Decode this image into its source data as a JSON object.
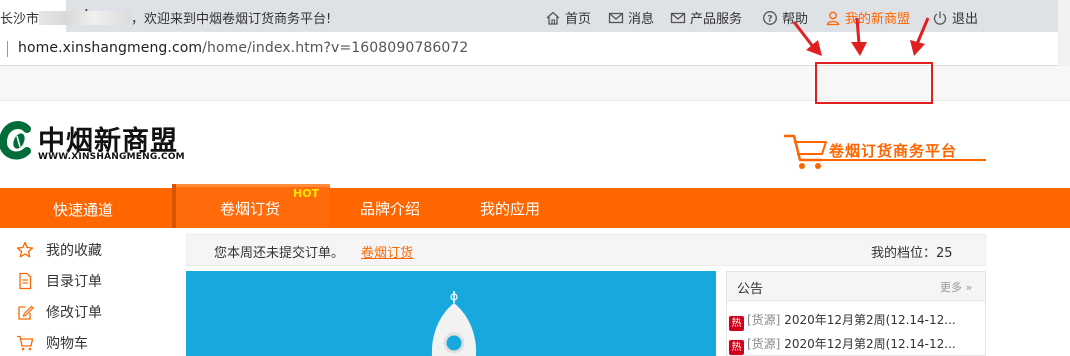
{
  "browser": {
    "tab_close": "×",
    "new_tab": "+",
    "url_host": "home.xinshangmeng.com",
    "url_path": "/home/index.htm?v=1608090786072"
  },
  "topbar": {
    "city": "长沙市",
    "welcome": "，欢迎来到中烟卷烟订货商务平台!",
    "nav": [
      {
        "label": "首页",
        "icon": "home-icon"
      },
      {
        "label": "消息",
        "icon": "mail-icon"
      },
      {
        "label": "产品服务",
        "icon": "mail-icon"
      },
      {
        "label": "帮助",
        "icon": "help-icon"
      },
      {
        "label": "我的新商盟",
        "icon": "user-icon"
      },
      {
        "label": "退出",
        "icon": "power-icon"
      }
    ]
  },
  "header": {
    "brand": "中烟新商盟",
    "domain": "WWW.XINSHANGMENG.COM",
    "platform": "卷烟订货商务平台"
  },
  "mainnav": {
    "quick": "快速通道",
    "tabs": [
      "卷烟订货",
      "品牌介绍",
      "我的应用"
    ],
    "hot": "HOT"
  },
  "sidebar": {
    "items": [
      {
        "label": "我的收藏",
        "icon": "star-icon"
      },
      {
        "label": "目录订单",
        "icon": "document-icon"
      },
      {
        "label": "修改订单",
        "icon": "edit-icon"
      },
      {
        "label": "购物车",
        "icon": "cart-icon"
      }
    ]
  },
  "notice": {
    "text": "您本周还未提交订单。",
    "link": "卷烟订货",
    "level": "我的档位：25"
  },
  "announcements": {
    "title": "公告",
    "more": "更多 »",
    "badge": "热",
    "items": [
      {
        "source": "[货源]",
        "text": " 2020年12月第2周(12.14-12..."
      },
      {
        "source": "[货源]",
        "text": " 2020年12月第2周(12.14-12..."
      }
    ]
  },
  "colors": {
    "accent": "#ff6600",
    "highlight": "#e02020",
    "banner": "#17a9dd"
  }
}
